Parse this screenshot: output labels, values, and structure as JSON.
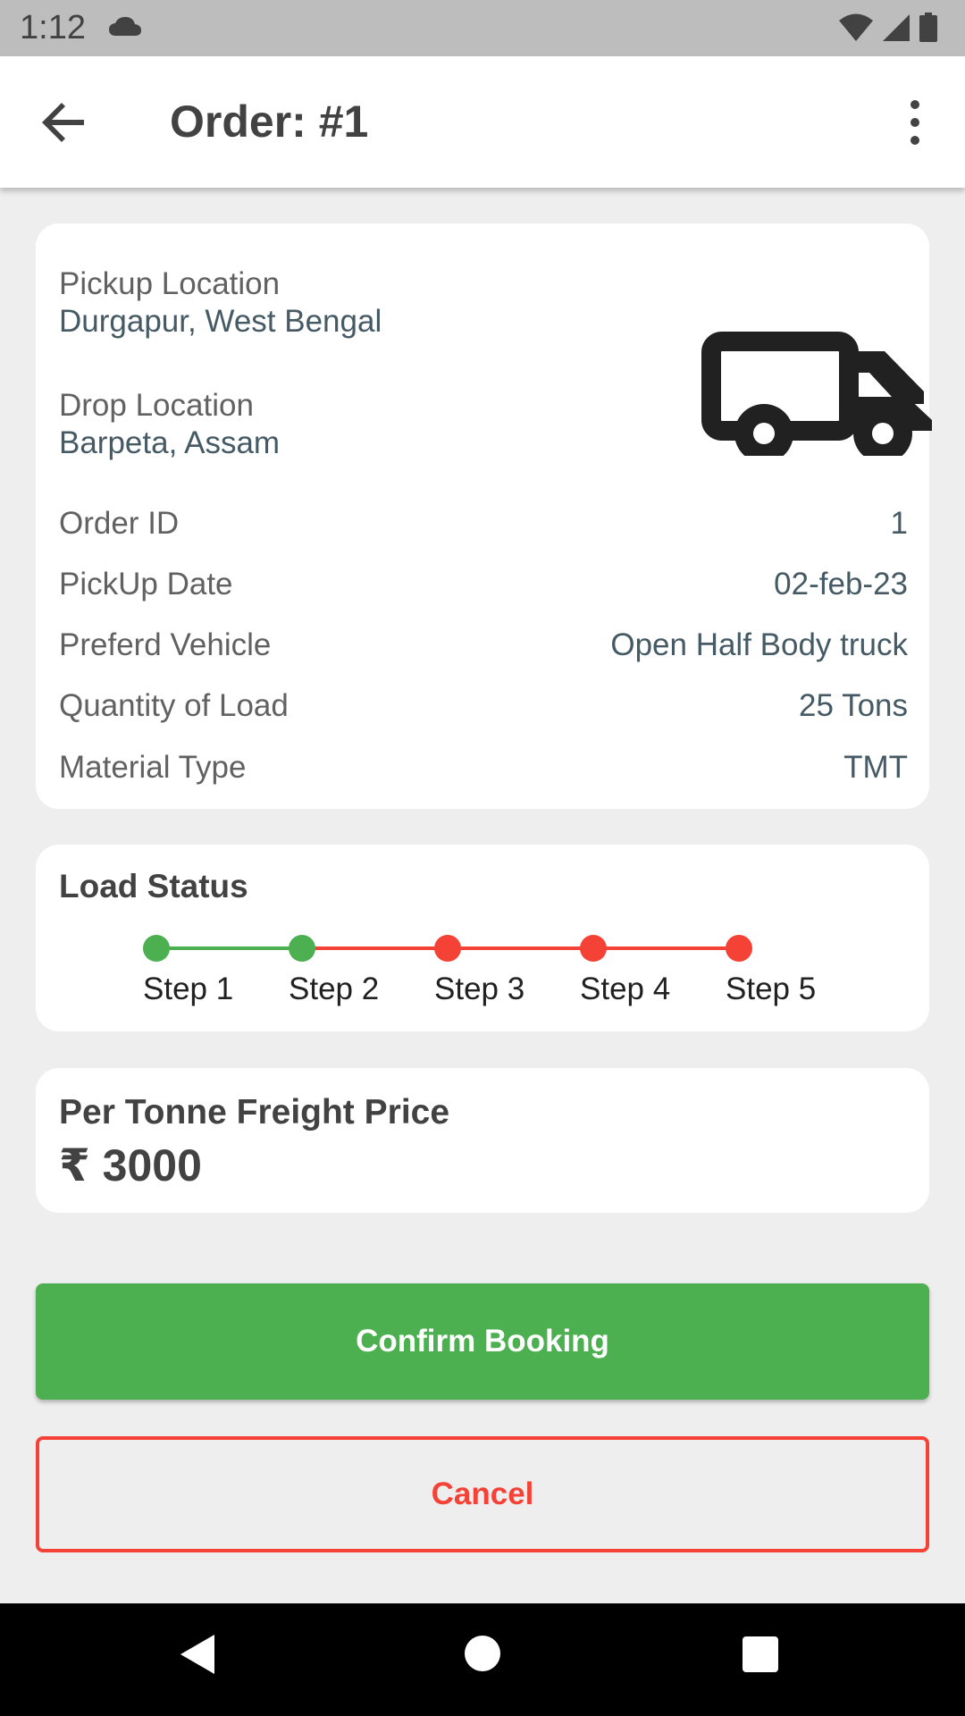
{
  "status_bar": {
    "time": "1:12",
    "icons": [
      "cloud-icon",
      "wifi-icon",
      "signal-icon",
      "battery-icon"
    ]
  },
  "app_bar": {
    "title": "Order: #1",
    "back_icon": "arrow-back-icon",
    "menu_icon": "more-vert-icon"
  },
  "details": {
    "pickup_label": "Pickup Location",
    "pickup_value": "Durgapur, West Bengal",
    "drop_label": "Drop Location",
    "drop_value": "Barpeta, Assam",
    "vehicle_icon": "truck-icon",
    "rows": [
      {
        "key": "Order ID",
        "value": "1"
      },
      {
        "key": "PickUp Date",
        "value": "02-feb-23"
      },
      {
        "key": "Preferd Vehicle",
        "value": "Open Half Body truck"
      },
      {
        "key": "Quantity of Load",
        "value": "25 Tons"
      },
      {
        "key": "Material Type",
        "value": "TMT"
      }
    ]
  },
  "load_status": {
    "title": "Load Status",
    "completed_steps": 2,
    "steps": [
      {
        "label": "Step 1",
        "state": "done"
      },
      {
        "label": "Step 2",
        "state": "done"
      },
      {
        "label": "Step 3",
        "state": "pending"
      },
      {
        "label": "Step 4",
        "state": "pending"
      },
      {
        "label": "Step 5",
        "state": "pending"
      }
    ],
    "colors": {
      "done": "#4caf50",
      "pending": "#f44336"
    }
  },
  "price": {
    "title": "Per Tonne Freight Price",
    "value": "₹ 3000"
  },
  "actions": {
    "confirm_label": "Confirm Booking",
    "cancel_label": "Cancel"
  },
  "colors": {
    "accent_green": "#4caf50",
    "accent_red": "#f44336",
    "background": "#eeeeee"
  },
  "nav_bar": {
    "icons": [
      "nav-back-icon",
      "nav-home-icon",
      "nav-recents-icon"
    ]
  }
}
